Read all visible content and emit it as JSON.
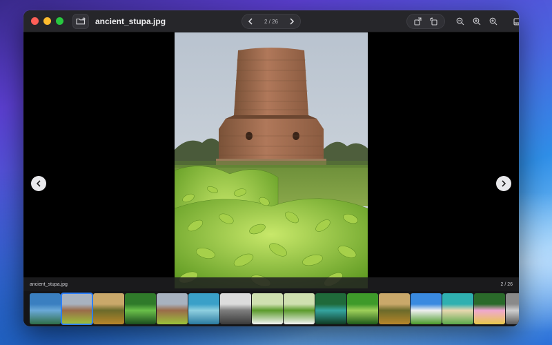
{
  "window": {
    "file_name": "ancient_stupa.jpg",
    "counter": "2 / 26"
  },
  "toolbar": {
    "icons": [
      "folder-open-icon",
      "chevron-left-icon",
      "chevron-right-icon",
      "share-icon",
      "rotate-icon",
      "zoom-out-icon",
      "zoom-in-icon",
      "zoom-fit-icon",
      "filmstrip-icon"
    ]
  },
  "infobar": {
    "file_name": "ancient_stupa.jpg",
    "counter": "2 / 26"
  },
  "filmstrip": {
    "selected_index": 1,
    "thumbs": [
      {
        "subject": "aerial-river",
        "colors": [
          "#3a7fc0",
          "#6aa9d8",
          "#2f6e48"
        ]
      },
      {
        "subject": "stupa",
        "colors": [
          "#a8b2bf",
          "#9a6b4a",
          "#9bc23a"
        ]
      },
      {
        "subject": "savanna-tree",
        "colors": [
          "#c9a86a",
          "#6b6a2a",
          "#b8862a"
        ]
      },
      {
        "subject": "forest-canopy",
        "colors": [
          "#2f7a2a",
          "#6ac04a",
          "#1b4d1e"
        ]
      },
      {
        "subject": "stupa",
        "colors": [
          "#a8b2bf",
          "#9a6b4a",
          "#9bc23a"
        ]
      },
      {
        "subject": "ocean-waves",
        "colors": [
          "#3aa0c8",
          "#8fd0e0",
          "#2a7aa0"
        ]
      },
      {
        "subject": "coastal-town",
        "colors": [
          "#dcdcdc",
          "#7d7d7d",
          "#3a3a3a"
        ]
      },
      {
        "subject": "white-flowers",
        "colors": [
          "#cfe0b0",
          "#5a9a2a",
          "#f5f5f5"
        ]
      },
      {
        "subject": "white-flowers",
        "colors": [
          "#cfe0b0",
          "#5a9a2a",
          "#f5f5f5"
        ]
      },
      {
        "subject": "jungle-pool",
        "colors": [
          "#1f6a3a",
          "#35a5a0",
          "#0f3a22"
        ]
      },
      {
        "subject": "palm-fronds",
        "colors": [
          "#3e9a2a",
          "#9ed05a",
          "#1e5a18"
        ]
      },
      {
        "subject": "savanna-tree",
        "colors": [
          "#c9a86a",
          "#6b6a2a",
          "#b8862a"
        ]
      },
      {
        "subject": "sky-grass",
        "colors": [
          "#3a8ae0",
          "#f0f0f0",
          "#4a9a2a"
        ]
      },
      {
        "subject": "beach",
        "colors": [
          "#2fb0b0",
          "#e8d8b0",
          "#5aa84a"
        ]
      },
      {
        "subject": "pink-flower",
        "colors": [
          "#2a6a2a",
          "#f0a8d0",
          "#e8c84a"
        ]
      },
      {
        "subject": "partial",
        "colors": [
          "#8a8a8a",
          "#cfcfcf",
          "#5a5a5a"
        ]
      }
    ]
  }
}
